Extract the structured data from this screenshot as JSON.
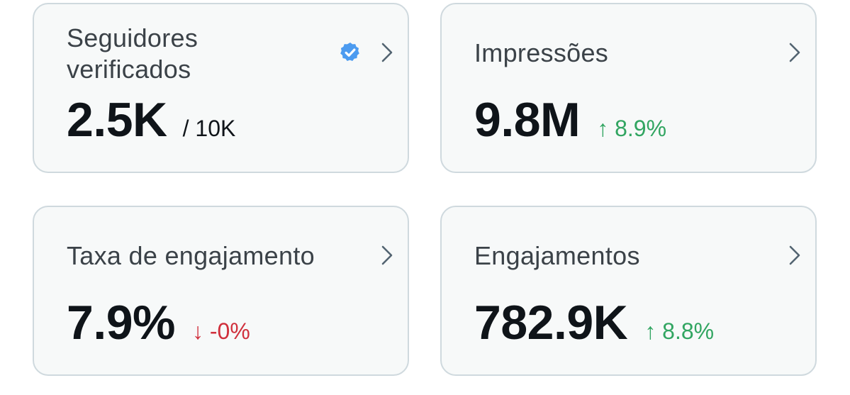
{
  "colors": {
    "card_background": "#f7f9f9",
    "card_border": "#cfd9de",
    "text_primary": "#0f1419",
    "label_text": "#3b4248",
    "positive": "#31a561",
    "negative": "#d0303c",
    "verified_blue": "#4c9bf0",
    "chevron": "#536471"
  },
  "cards": [
    {
      "label": "Seguidores\nverificados",
      "value": "2.5K",
      "denominator": "/ 10K",
      "badge_icon": "verified-badge-icon",
      "action_icon": "chevron-right-icon"
    },
    {
      "label": "Impressões",
      "value": "9.8M",
      "change": "↑ 8.9%",
      "change_direction": "up",
      "action_icon": "chevron-right-icon"
    },
    {
      "label": "Taxa de engajamento",
      "value": "7.9%",
      "change": "↓ -0%",
      "change_direction": "down",
      "action_icon": "chevron-right-icon"
    },
    {
      "label": "Engajamentos",
      "value": "782.9K",
      "change": "↑ 8.8%",
      "change_direction": "up",
      "action_icon": "chevron-right-icon"
    }
  ]
}
